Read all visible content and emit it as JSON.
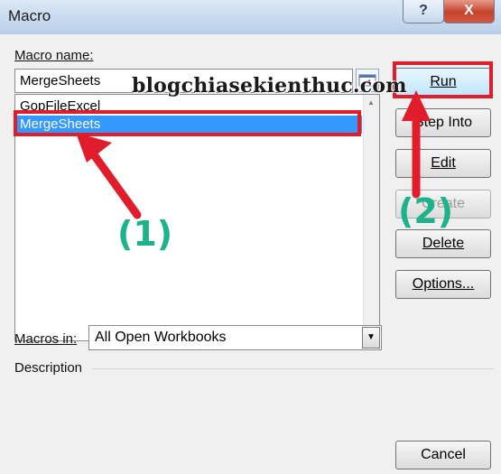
{
  "window": {
    "title": "Macro",
    "help_glyph": "?",
    "close_glyph": "X"
  },
  "macro_name": {
    "label": "Macro name:",
    "value": "MergeSheets"
  },
  "macro_list": {
    "items": [
      "GopFileExcel",
      "MergeSheets"
    ],
    "selected": "MergeSheets"
  },
  "buttons": {
    "run": "Run",
    "step_into": "Step Into",
    "edit": "Edit",
    "create": "Create",
    "delete": "Delete",
    "options": "Options...",
    "cancel": "Cancel"
  },
  "macros_in": {
    "label": "Macros in:",
    "value": "All Open Workbooks"
  },
  "description": {
    "label": "Description"
  },
  "annotations": {
    "watermark": "blogchiasekienthuc.com",
    "step1": "(1)",
    "step2": "(2)",
    "accent_color": "#e11d2b",
    "step_color": "#1db38a"
  },
  "icons": {
    "help": "question-mark-icon",
    "close": "close-icon",
    "refedit": "collapse-dialog-icon",
    "dropdown": "chevron-down-icon",
    "scroll_up": "scroll-up-arrow-icon",
    "scroll_down": "scroll-down-arrow-icon"
  }
}
